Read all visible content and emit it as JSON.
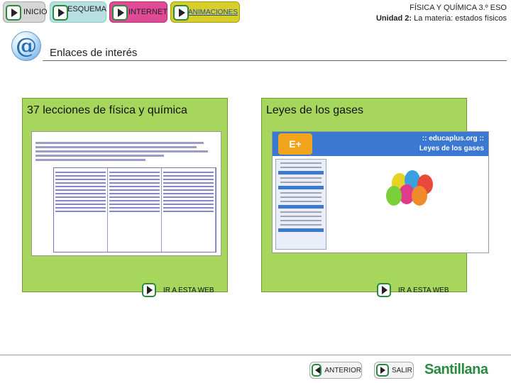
{
  "nav": {
    "inicio": "INICIO",
    "esquema": "ESQUEMA",
    "internet": "INTERNET",
    "animaciones": "ANIMACIONES"
  },
  "header": {
    "course": "FÍSICA Y QUÍMICA 3.º ESO",
    "unit_label": "Unidad 2:",
    "unit_title": "La materia: estados físicos"
  },
  "section": {
    "icon": "at-sign-icon",
    "title": "Enlaces de interés"
  },
  "panels": [
    {
      "title": "37 lecciones de física y química",
      "button": "IR A ESTA WEB"
    },
    {
      "title": "Leyes de los gases",
      "button": "IR A ESTA WEB"
    }
  ],
  "preview_right": {
    "logo": "E+",
    "title_line1": ":: educaplus.org ::",
    "title_line2": "Leyes de los gases"
  },
  "footer": {
    "back": "ANTERIOR",
    "exit": "SALIR",
    "brand": "Santillana"
  },
  "colors": {
    "panel": "#a6d75c",
    "internet_tab": "#e04b96",
    "animaciones_tab": "#d8ce2a",
    "esquema_tab": "#b9dfe0",
    "brand_green": "#2a8a3e"
  }
}
